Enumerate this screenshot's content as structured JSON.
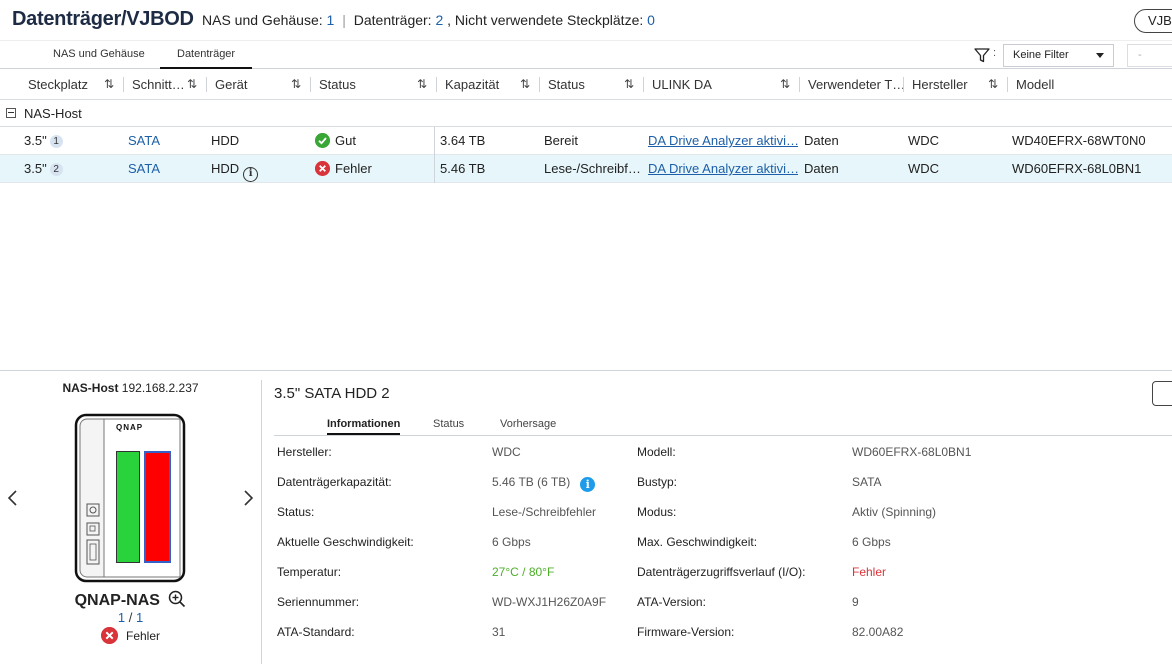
{
  "header": {
    "title": "Datenträger/VJBOD",
    "nas_label": "NAS und Gehäuse:",
    "nas_count": "1",
    "disk_label": "Datenträger:",
    "disk_count": "2",
    "unused_label": ", Nicht verwendete Steckplätze:",
    "unused_count": "0",
    "vjbod_button": "VJB"
  },
  "tabs": [
    {
      "label": "NAS und Gehäuse",
      "active": false
    },
    {
      "label": "Datenträger",
      "active": true
    }
  ],
  "filter": {
    "colon": ":",
    "selected": "Keine Filter",
    "search_placeholder": "-"
  },
  "table": {
    "columns": [
      "Steckplatz",
      "Schnitt…",
      "Gerät",
      "Status",
      "Kapazität",
      "Status",
      "ULINK DA",
      "Verwendeter T…",
      "Hersteller",
      "Modell"
    ],
    "group": "NAS-Host",
    "rows": [
      {
        "slot": "3.5\"",
        "slot_num": "1",
        "interface": "SATA",
        "device": "HDD",
        "health": "Gut",
        "capacity": "3.64 TB",
        "state": "Bereit",
        "ulink": "DA Drive Analyzer aktivi…",
        "type": "Daten",
        "vendor": "WDC",
        "model": "WD40EFRX-68WT0N0"
      },
      {
        "slot": "3.5\"",
        "slot_num": "2",
        "interface": "SATA",
        "device": "HDD",
        "health": "Fehler",
        "capacity": "5.46 TB",
        "state": "Lese-/Schreibf…",
        "ulink": "DA Drive Analyzer aktivi…",
        "type": "Daten",
        "vendor": "WDC",
        "model": "WD60EFRX-68L0BN1"
      }
    ]
  },
  "left_panel": {
    "host_label": "NAS-Host",
    "host_ip": "192.168.2.237",
    "brand": "QNAP",
    "device_name": "QNAP-NAS",
    "page_current": "1",
    "page_sep": "/",
    "page_total": "1",
    "status": "Fehler"
  },
  "detail": {
    "title": "3.5\" SATA HDD 2",
    "tabs": [
      "Informationen",
      "Status",
      "Vorhersage"
    ],
    "left": [
      {
        "label": "Hersteller:",
        "value": "WDC"
      },
      {
        "label": "Datenträgerkapazität:",
        "value": "5.46 TB (6 TB)"
      },
      {
        "label": "Status:",
        "value": "Lese-/Schreibfehler"
      },
      {
        "label": "Aktuelle Geschwindigkeit:",
        "value": "6 Gbps"
      },
      {
        "label": "Temperatur:",
        "value": "27°C / 80°F"
      },
      {
        "label": "Seriennummer:",
        "value": "WD-WXJ1H26Z0A9F"
      },
      {
        "label": "ATA-Standard:",
        "value": "31"
      }
    ],
    "right": [
      {
        "label": "Modell:",
        "value": "WD60EFRX-68L0BN1"
      },
      {
        "label": "Bustyp:",
        "value": "SATA"
      },
      {
        "label": "Modus:",
        "value": "Aktiv (Spinning)"
      },
      {
        "label": "Max. Geschwindigkeit:",
        "value": "6 Gbps"
      },
      {
        "label": "Datenträgerzugriffsverlauf (I/O):",
        "value": "Fehler"
      },
      {
        "label": "ATA-Version:",
        "value": "9"
      },
      {
        "label": "Firmware-Version:",
        "value": "82.00A82"
      }
    ]
  },
  "colors": {
    "accent": "#1d5fa8",
    "ok": "#3aa635",
    "error": "#d9343a",
    "slot_ok": "#28d33c",
    "slot_error": "#ff0000",
    "selected_row": "#e6f6fa",
    "temp_green": "#4caf28"
  }
}
